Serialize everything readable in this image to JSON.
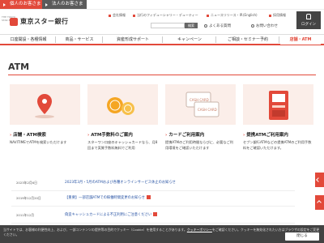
{
  "topbar": {
    "personal": "個人のお客さま",
    "corporate": "法人のお客さま"
  },
  "brand": {
    "name": "東京スター銀行",
    "sub": "THE TOKYO STAR BANK"
  },
  "utility_links": [
    "会社情報",
    "当行のフィデューシャリー・デューティー",
    "ニュースリリース・IR",
    "(English)",
    "採用情報"
  ],
  "search": {
    "placeholder": "",
    "button": "検索"
  },
  "row2_links": [
    "よくある質問",
    "お問い合わせ"
  ],
  "login": "ログイン",
  "nav": [
    "口座開設・各種情報",
    "商品・サービス",
    "資産形成サポート",
    "キャンペーン",
    "ご相談・セミナー予約",
    "店舗・ATM"
  ],
  "nav_active_index": 5,
  "page_title": "ATM",
  "cards": [
    {
      "title": "店舗・ATM検索",
      "text": "NAVITIMEでATMを検索いただけます"
    },
    {
      "title": "ATM手数料のご案内",
      "text": "スターワン口座のキャッシュカードなら、月8回まで実質手数料無料でご利用"
    },
    {
      "title": "カードご利用案内",
      "text": "提携ATMのご利用時間ならびに、必要なご利用環境をご確認いただけます"
    },
    {
      "title": "提携ATMご利用案内",
      "text": "セブン銀行ATMなどの提携ATMのご利用手数料をご確認いただけます。"
    }
  ],
  "card_image_labels": [
    "CASH CARD",
    "CASH CARD"
  ],
  "news": [
    {
      "date": "2023年2月6日",
      "title": "2023年3月・5月のATMおよび各種オンラインサービス休止のお知らせ",
      "pdf": false
    },
    {
      "date": "2019年12月20日",
      "title": "【重要】一部店舗ATMでの稼働時間変更のお知らせ",
      "pdf": true
    },
    {
      "date": "2011年12月",
      "title": "偽造キャッシュカードによる不正利用にご注意ください",
      "pdf": true
    }
  ],
  "cookie": {
    "text": "当サイトでは、お客様の利便性向上、および、一部コンテンツの提供等の目的でクッキー（Cookie）を使用することがあります。",
    "link_label": "クッキーポリシー",
    "text2": "をご確認ください。クッキーを無効化されたい方はブラウザの設定をご変更ください。",
    "close": "閉じる"
  },
  "colors": {
    "accent": "#e2493a",
    "dark": "#444444",
    "card_bg": "#fbeee9",
    "link": "#2a55a5"
  }
}
